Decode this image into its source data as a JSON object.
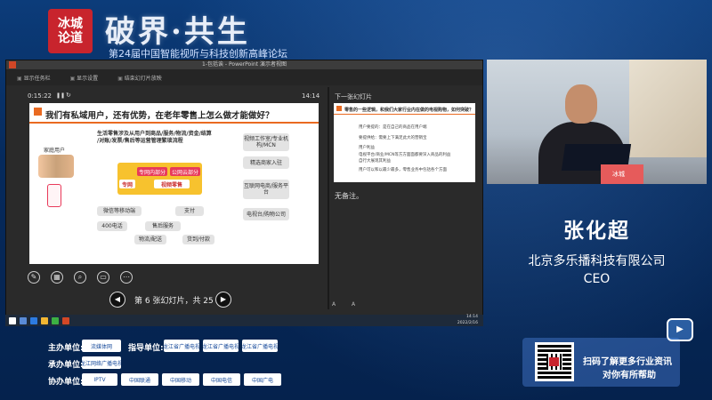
{
  "banner": {
    "logo_text_1": "冰城",
    "logo_text_2": "论道",
    "title": "破界·共生",
    "subtitle": "第24届中国智能视听与科技创新高峰论坛"
  },
  "powerpoint": {
    "window_title": "1-包括诶 - PowerPoint 演示者视图",
    "toolbar": [
      "显示任务栏",
      "显示设置",
      "结束幻灯片放映"
    ],
    "timer": "0:15:22",
    "clock": "14:14",
    "next_slide_label": "下一张幻灯片",
    "notes_text": "无备注。",
    "slide_count": "第 6 张幻灯片，共 25 张",
    "tools": [
      "pen-icon",
      "grid-icon",
      "zoom-icon",
      "subtitle-icon",
      "more-icon"
    ],
    "font_buttons": [
      "A",
      "A"
    ]
  },
  "current_slide": {
    "title": "我们有私域用户，还有优势，在老年零售上怎么做才能做好？",
    "header_text_1": "生活零售涉及从用户到商品/服务/物流/资金/结算",
    "header_text_2": "/对账/发票/售后等运营管理繁琐流程",
    "family_label": "家庭用户",
    "boxes": [
      "视频工作室/专业机构/MCN",
      "精选商家入驻",
      "互联网电商/服务平台",
      "电视台/购物公司",
      "微信等移动端",
      "支付",
      "400电话",
      "售后服务",
      "物流/配送",
      "货到/付款"
    ],
    "pink_1": "专网内部分",
    "pink_2": "公网云部分",
    "white_1": "专网",
    "white_2": "视频零售"
  },
  "next_slide": {
    "title": "零售的一些逻辑，和我们大家行业内在做的电视购物，如何突破？",
    "lines": [
      "用户要提的：是在自己的商品在用户端",
      "要提供给：需要上下满足此大的营销宝",
      "用户利益",
      "电视平台/商业/MCN等方方面面都要深入商品的利益",
      "自行大展现其利益",
      "用户可以和以最少最多，零售业务中包括各个方面"
    ]
  },
  "taskbar": {
    "time": "14:14",
    "date": "2022/2/16"
  },
  "speaker": {
    "name": "张化超",
    "company": "北京多乐播科技有限公司",
    "role": "CEO",
    "podium_mark": "冰城"
  },
  "sponsors": {
    "host_label": "主办单位:",
    "guide_label": "指导单位:",
    "organizer_label": "承办单位:",
    "co_label": "协办单位:",
    "host_logo": "流媒体网",
    "guide_logos": [
      "黑龙江省广播电视局",
      "黑龙江省广播电视局",
      "黑龙江省广播电视局"
    ],
    "organizer_logo": "黑龙江网络广播电视台",
    "co_logos": [
      "IPTV",
      "中国联通",
      "中国移动",
      "中国电信",
      "中国广电"
    ]
  },
  "qr": {
    "line1": "扫码了解更多行业资讯",
    "line2": "对你有所帮助"
  },
  "tv_icon_label": "tv-icon",
  "colors": {
    "background": "#062a5c",
    "accent_orange": "#e96a21",
    "brand_red": "#c8242d"
  }
}
